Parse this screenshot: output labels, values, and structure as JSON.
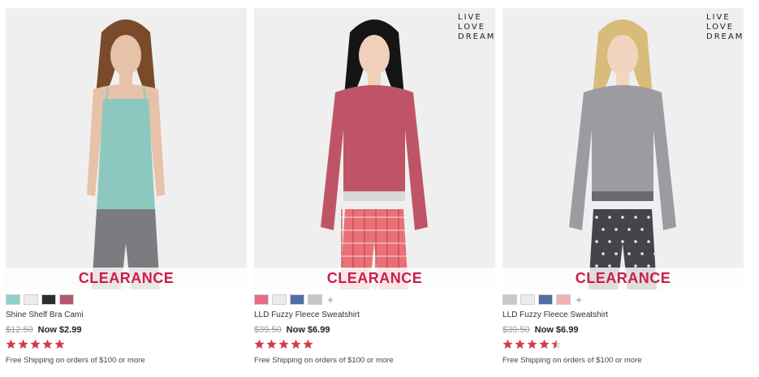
{
  "products": [
    {
      "name": "Shine Shelf Bra Cami",
      "was_price": "$12.50",
      "now_price": "Now $2.99",
      "badge": "CLEARANCE",
      "brand_logo": "",
      "rating": 5,
      "shipping": "Free Shipping on orders of $100 or more",
      "swatches": [
        "#8fd1c8",
        "#ececec",
        "#2d2d2d",
        "#b45a6e"
      ],
      "more_swatches": "",
      "colors": {
        "bg": "#efefef",
        "top": "#8cc8c0",
        "bottom": "#7c7c80",
        "skin": "#e7c1a8",
        "hair": "#7a4a2a"
      }
    },
    {
      "name": "LLD Fuzzy Fleece Sweatshirt",
      "was_price": "$39.50",
      "now_price": "Now $6.99",
      "badge": "CLEARANCE",
      "brand_logo": "LIVE LOVE DREAM",
      "rating": 5,
      "shipping": "Free Shipping on orders of $100 or more",
      "swatches": [
        "#e56e86",
        "#ececec",
        "#4f6fa6",
        "#c6c6c6"
      ],
      "more_swatches": "+",
      "colors": {
        "bg": "#efefef",
        "top": "#c05467",
        "bottom": "#ea6f77",
        "skin": "#f0d0ba",
        "hair": "#151515"
      }
    },
    {
      "name": "LLD Fuzzy Fleece Sweatshirt",
      "was_price": "$39.50",
      "now_price": "Now $6.99",
      "badge": "CLEARANCE",
      "brand_logo": "LIVE LOVE DREAM",
      "rating": 4.5,
      "shipping": "Free Shipping on orders of $100 or more",
      "swatches": [
        "#c8c8c8",
        "#ececec",
        "#4f6fa6",
        "#f4b0b0"
      ],
      "more_swatches": "+",
      "colors": {
        "bg": "#efefef",
        "top": "#9b9ba1",
        "bottom": "#44444a",
        "skin": "#f2d5bf",
        "hair": "#d9bb7a"
      }
    }
  ],
  "star_color": "#d23a4c"
}
